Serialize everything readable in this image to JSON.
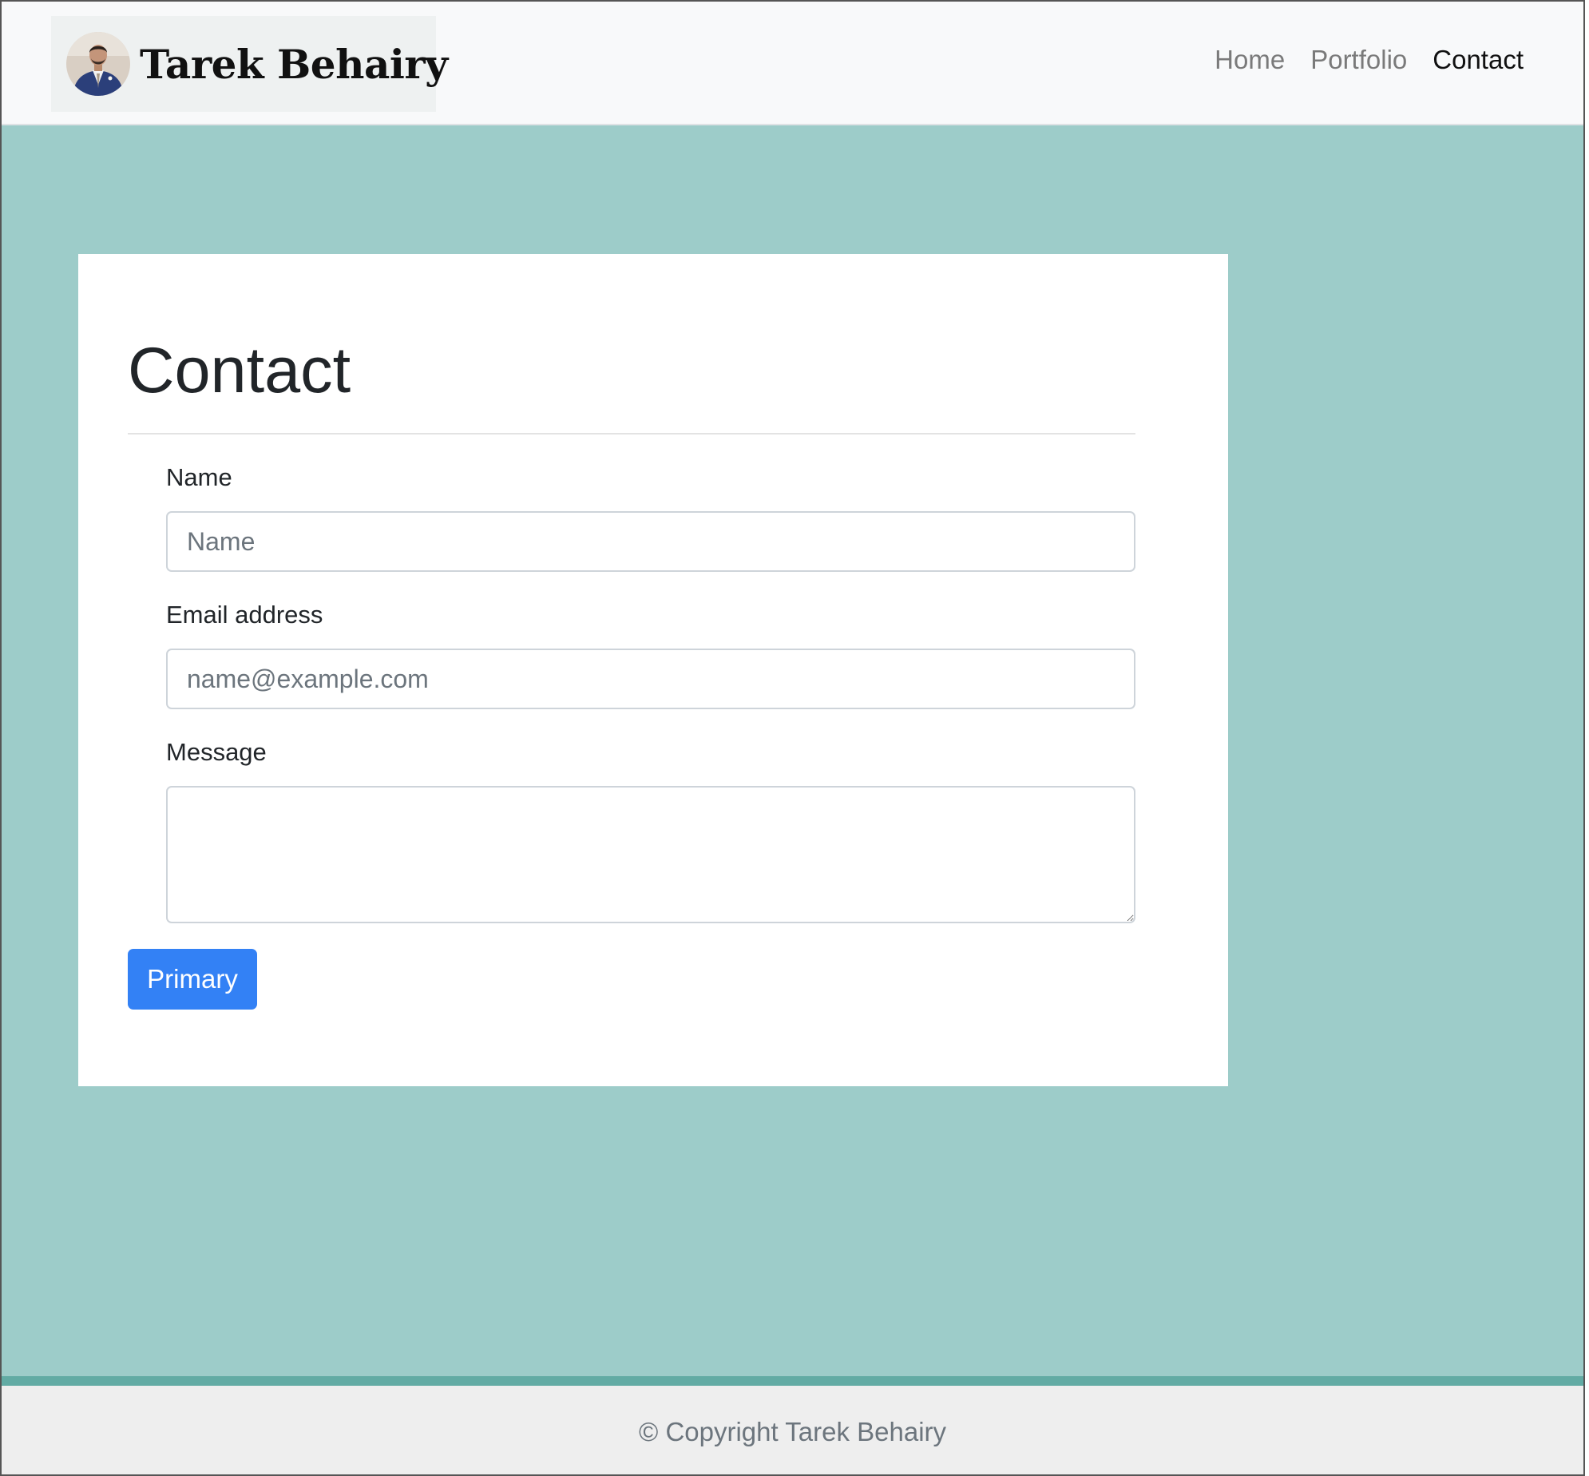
{
  "brand": {
    "name": "Tarek Behairy",
    "avatar_icon": "person-photo-icon"
  },
  "nav": {
    "items": [
      {
        "label": "Home",
        "active": false
      },
      {
        "label": "Portfolio",
        "active": false
      },
      {
        "label": "Contact",
        "active": true
      }
    ]
  },
  "form": {
    "title": "Contact",
    "name_label": "Name",
    "name_placeholder": "Name",
    "name_value": "",
    "email_label": "Email address",
    "email_placeholder": "name@example.com",
    "email_value": "",
    "message_label": "Message",
    "message_value": "",
    "submit_label": "Primary"
  },
  "footer": {
    "text": "© Copyright Tarek Behairy"
  },
  "colors": {
    "background": "#9dccc9",
    "button": "#3381f5",
    "footer_accent": "#62aba4"
  }
}
